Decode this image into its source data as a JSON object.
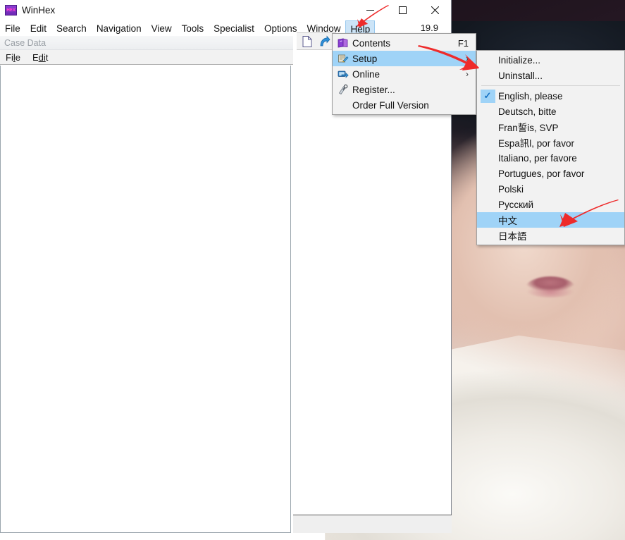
{
  "window": {
    "title": "WinHex",
    "app_icon": "winhex-hex-icon",
    "version_label": "19.9",
    "controls": {
      "minimize": "minimize-button",
      "maximize": "maximize-button",
      "close": "close-button"
    }
  },
  "menubar": {
    "items": [
      {
        "label": "File",
        "active": false
      },
      {
        "label": "Edit",
        "active": false
      },
      {
        "label": "Search",
        "active": false
      },
      {
        "label": "Navigation",
        "active": false
      },
      {
        "label": "View",
        "active": false
      },
      {
        "label": "Tools",
        "active": false
      },
      {
        "label": "Specialist",
        "active": false
      },
      {
        "label": "Options",
        "active": false
      },
      {
        "label": "Window",
        "active": false
      },
      {
        "label": "Help",
        "active": true
      }
    ]
  },
  "toolbar": {
    "buttons": [
      {
        "icon": "new-file-icon"
      },
      {
        "icon": "blue-arrow-icon"
      }
    ]
  },
  "case_panel": {
    "title": "Case Data",
    "menu": [
      {
        "label": "File",
        "accel_index": 2
      },
      {
        "label": "Edit",
        "accel_index": 1
      }
    ]
  },
  "help_menu": {
    "items": [
      {
        "label": "Contents",
        "icon": "book-icon",
        "shortcut": "F1",
        "submenu": false,
        "selected": false
      },
      {
        "label": "Setup",
        "icon": "setup-icon",
        "shortcut": "",
        "submenu": true,
        "selected": true
      },
      {
        "label": "Online",
        "icon": "online-icon",
        "shortcut": "",
        "submenu": true,
        "selected": false
      },
      {
        "label": "Register...",
        "icon": "register-icon",
        "shortcut": "",
        "submenu": false,
        "selected": false
      },
      {
        "label": "Order Full Version",
        "icon": "",
        "shortcut": "",
        "submenu": false,
        "selected": false
      }
    ]
  },
  "setup_submenu": {
    "items": [
      {
        "label": "Initialize...",
        "checked": false,
        "selected": false,
        "separator_after": false
      },
      {
        "label": "Uninstall...",
        "checked": false,
        "selected": false,
        "separator_after": true
      },
      {
        "label": "English, please",
        "checked": true,
        "selected": false,
        "separator_after": false
      },
      {
        "label": "Deutsch, bitte",
        "checked": false,
        "selected": false,
        "separator_after": false
      },
      {
        "label": "Fran誓is, SVP",
        "checked": false,
        "selected": false,
        "separator_after": false
      },
      {
        "label": "Espa訊l, por favor",
        "checked": false,
        "selected": false,
        "separator_after": false
      },
      {
        "label": "Italiano, per favore",
        "checked": false,
        "selected": false,
        "separator_after": false
      },
      {
        "label": "Portugues, por favor",
        "checked": false,
        "selected": false,
        "separator_after": false
      },
      {
        "label": "Polski",
        "checked": false,
        "selected": false,
        "separator_after": false
      },
      {
        "label": "Русский",
        "checked": false,
        "selected": false,
        "separator_after": false
      },
      {
        "label": "中文",
        "checked": false,
        "selected": true,
        "separator_after": false
      },
      {
        "label": "日本語",
        "checked": false,
        "selected": false,
        "separator_after": false
      }
    ]
  },
  "annotations": [
    {
      "name": "arrow-pointing-to-help-menu",
      "color": "#ee2b2b"
    },
    {
      "name": "arrow-pointing-to-setup-item",
      "color": "#ee2b2b"
    },
    {
      "name": "arrow-pointing-to-chinese-item",
      "color": "#ee2b2b"
    }
  ],
  "colors": {
    "menu_highlight": "#9fd3f7",
    "menubar_active": "#cce4f7",
    "annotation_red": "#ee2b2b",
    "popup_bg": "#f2f2f2",
    "window_bg": "#ffffff"
  },
  "desktop": {
    "wallpaper": "portrait-photo-woman-with-golden-headdress"
  }
}
